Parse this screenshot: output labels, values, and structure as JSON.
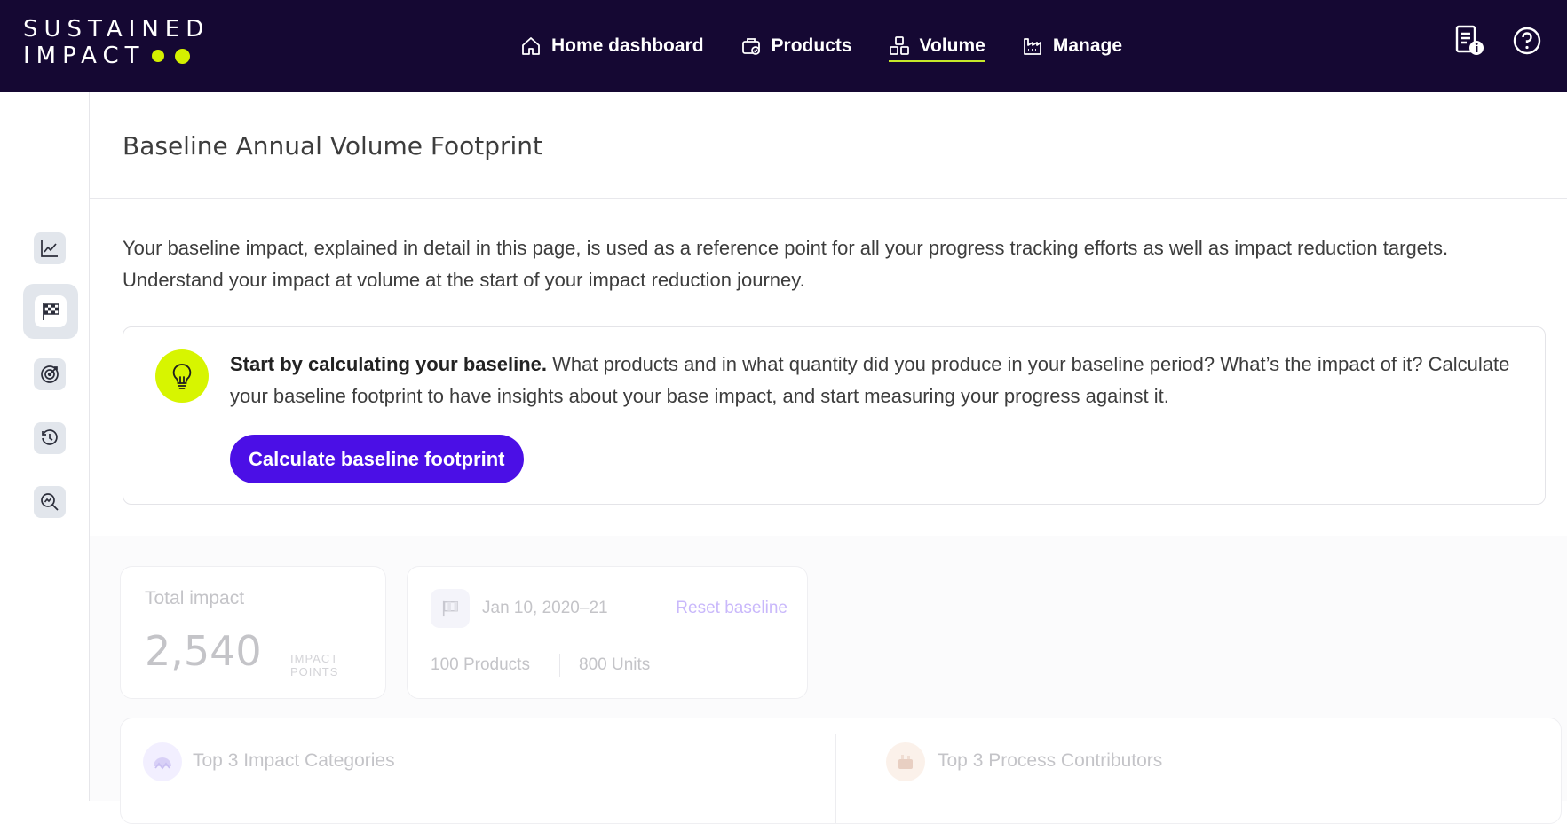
{
  "brand": {
    "line1": "SUSTAINED",
    "line2": "IMPACT",
    "accent": "#d4f000"
  },
  "nav": {
    "items": [
      {
        "label": "Home dashboard",
        "icon": "home-icon"
      },
      {
        "label": "Products",
        "icon": "products-icon"
      },
      {
        "label": "Volume",
        "icon": "volume-icon",
        "active": true
      },
      {
        "label": "Manage",
        "icon": "factory-icon"
      }
    ],
    "right_icons": [
      "document-info-icon",
      "help-icon"
    ]
  },
  "sidebar": {
    "items": [
      {
        "icon": "chart-line-icon"
      },
      {
        "icon": "flag-icon",
        "active": true
      },
      {
        "icon": "target-icon"
      },
      {
        "icon": "history-icon"
      },
      {
        "icon": "analysis-search-icon"
      }
    ]
  },
  "page": {
    "title": "Baseline Annual Volume Footprint",
    "intro": "Your baseline impact, explained in detail in this page, is used as a reference point for all your progress tracking efforts as well as impact reduction targets. Understand your impact at volume at the start of your impact reduction journey."
  },
  "callout": {
    "bold": "Start by calculating your baseline.",
    "text": " What products and in what quantity did you produce in your baseline period? What’s the impact of it? Calculate your baseline footprint to have insights about your base impact, and start measuring your progress against it.",
    "button": "Calculate baseline footprint",
    "button_color": "#4b0fe6"
  },
  "summary": {
    "total_label": "Total impact",
    "total_value": "2,540",
    "total_unit": "IMPACT POINTS",
    "period": "Jan 10, 2020–21",
    "reset": "Reset baseline",
    "products": "100 Products",
    "units": "800 Units"
  },
  "sections": {
    "categories": "Top 3 Impact Categories",
    "processes": "Top 3 Process Contributors"
  }
}
